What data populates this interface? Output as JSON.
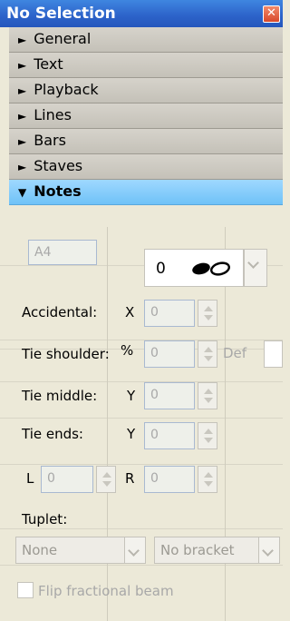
{
  "window": {
    "title": "No Selection",
    "close_label": "✕"
  },
  "sections": [
    {
      "label": "General",
      "expanded": false
    },
    {
      "label": "Text",
      "expanded": false
    },
    {
      "label": "Playback",
      "expanded": false
    },
    {
      "label": "Lines",
      "expanded": false
    },
    {
      "label": "Bars",
      "expanded": false
    },
    {
      "label": "Staves",
      "expanded": false
    },
    {
      "label": "Notes",
      "expanded": true
    }
  ],
  "notes": {
    "pitch_value": "A4",
    "duration_value": "0",
    "duration_icon": "double-whole-note-icon",
    "accidental": {
      "label": "Accidental:",
      "axis": "X",
      "value": "0"
    },
    "tie_shoulder": {
      "label": "Tie shoulder:",
      "axis": "%",
      "value": "0",
      "default_label": "Def"
    },
    "tie_middle": {
      "label": "Tie middle:",
      "axis": "Y",
      "value": "0"
    },
    "tie_ends": {
      "label": "Tie ends:",
      "axis": "Y",
      "value": "0"
    },
    "l_label": "L",
    "l_value": "0",
    "r_label": "R",
    "r_value": "0",
    "tuplet": {
      "label": "Tuplet:",
      "type_value": "None",
      "bracket_value": "No bracket"
    },
    "flip_fractional_beam": {
      "label": "Flip fractional beam",
      "checked": false
    }
  },
  "colors": {
    "title_bar": "#2c62c9",
    "active_section": "#6fc2f7",
    "panel_bg": "#ece9d8"
  }
}
